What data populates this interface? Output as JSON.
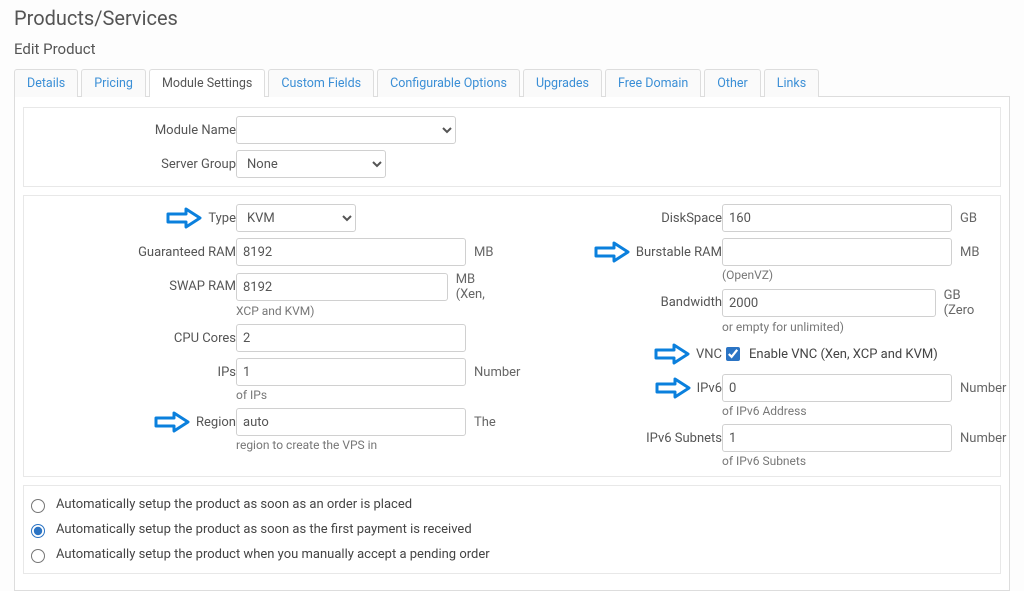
{
  "page": {
    "title": "Products/Services",
    "subtitle": "Edit Product"
  },
  "tabs": {
    "t0": "Details",
    "t1": "Pricing",
    "t2": "Module Settings",
    "t3": "Custom Fields",
    "t4": "Configurable Options",
    "t5": "Upgrades",
    "t6": "Free Domain",
    "t7": "Other",
    "t8": "Links",
    "active": 2
  },
  "top": {
    "module_name_label": "Module Name",
    "module_name_value": "",
    "server_group_label": "Server Group",
    "server_group_value": "None"
  },
  "left": {
    "type_label": "Type",
    "type_value": "KVM",
    "guaranteed_ram_label": "Guaranteed RAM",
    "guaranteed_ram_value": "8192",
    "guaranteed_ram_unit": "MB",
    "swap_ram_label": "SWAP RAM",
    "swap_ram_value": "8192",
    "swap_ram_unit": "MB (Xen,",
    "swap_ram_help": "XCP and KVM)",
    "cpu_label": "CPU Cores",
    "cpu_value": "2",
    "ips_label": "IPs",
    "ips_value": "1",
    "ips_unit": "Number",
    "ips_help": "of IPs",
    "region_label": "Region",
    "region_value": "auto",
    "region_unit": "The",
    "region_help": "region to create the VPS in"
  },
  "right": {
    "disk_label": "DiskSpace",
    "disk_value": "160",
    "disk_unit": "GB",
    "burst_label": "Burstable RAM",
    "burst_value": "",
    "burst_unit": "MB",
    "burst_help": "(OpenVZ)",
    "bw_label": "Bandwidth",
    "bw_value": "2000",
    "bw_unit": "GB (Zero",
    "bw_help": "or empty for unlimited)",
    "vnc_label": "VNC",
    "vnc_text": "Enable VNC (Xen, XCP and KVM)",
    "vnc_checked": true,
    "ipv6_label": "IPv6",
    "ipv6_value": "0",
    "ipv6_unit": "Number",
    "ipv6_help": "of IPv6 Address",
    "ipv6s_label": "IPv6 Subnets",
    "ipv6s_value": "1",
    "ipv6s_unit": "Number",
    "ipv6s_help": "of IPv6 Subnets"
  },
  "setup": {
    "r0": "Automatically setup the product as soon as an order is placed",
    "r1": "Automatically setup the product as soon as the first payment is received",
    "r2": "Automatically setup the product when you manually accept a pending order",
    "checked": 1
  }
}
